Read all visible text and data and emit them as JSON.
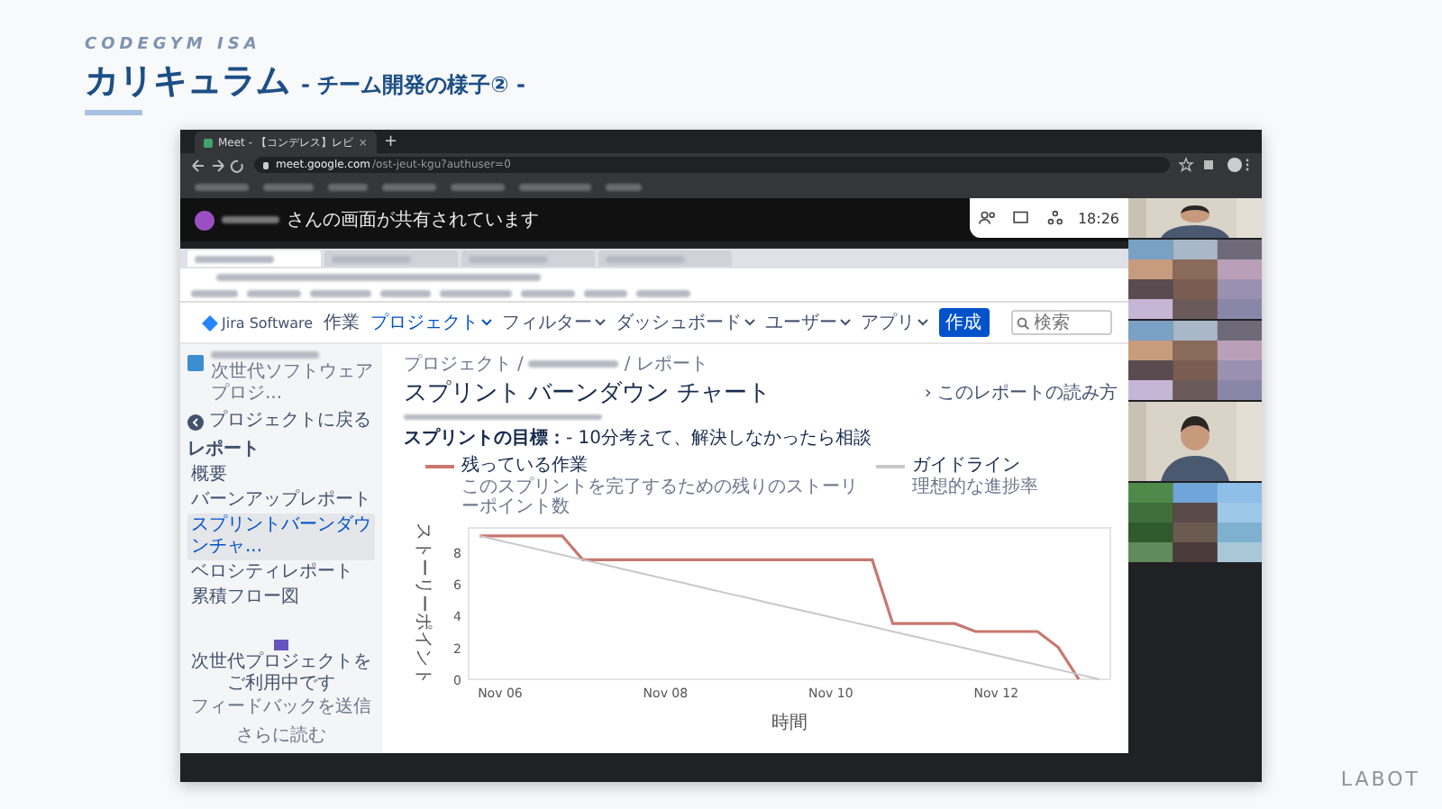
{
  "slide": {
    "brand": "CODEGYM ISA",
    "title": "カリキュラム",
    "subtitle": "- チーム開発の様子② -",
    "logo": "LABOT"
  },
  "browser": {
    "tabs": [
      {
        "label": "Meet - 【コンデレス】レビ",
        "selected": true,
        "close": "×"
      }
    ],
    "new_tab": "+",
    "url_host": "meet.google.com",
    "url_path": "/ost-jeut-kgu?authuser=0"
  },
  "meet": {
    "presenting_text": "さんの画面が共有されています",
    "time": "18:26",
    "tiles": [
      {
        "kind": "person"
      },
      {
        "kind": "mosaic"
      },
      {
        "kind": "mosaic"
      },
      {
        "kind": "person"
      },
      {
        "kind": "mosaic"
      }
    ]
  },
  "inner_browser": {
    "tabs": [
      {
        "selected": true
      },
      {
        "selected": false
      },
      {
        "selected": false
      },
      {
        "selected": false
      }
    ]
  },
  "jira": {
    "product": "Jira Software",
    "nav": [
      {
        "label": "作業",
        "dropdown": false,
        "selected": false
      },
      {
        "label": "プロジェクト",
        "dropdown": true,
        "selected": true
      },
      {
        "label": "フィルター",
        "dropdown": true,
        "selected": false
      },
      {
        "label": "ダッシュボード",
        "dropdown": true,
        "selected": false
      },
      {
        "label": "ユーザー",
        "dropdown": true,
        "selected": false
      },
      {
        "label": "アプリ",
        "dropdown": true,
        "selected": false
      }
    ],
    "create_button": "作成",
    "search": {
      "placeholder": "検索"
    },
    "sidebar": {
      "project_type": "次世代ソフトウェアプロジ...",
      "back": "プロジェクトに戻る",
      "heading": "レポート",
      "items": [
        {
          "label": "概要",
          "selected": false
        },
        {
          "label": "バーンアップレポート",
          "selected": false
        },
        {
          "label": "スプリントバーンダウンチャ...",
          "selected": true
        },
        {
          "label": "ベロシティレポート",
          "selected": false
        },
        {
          "label": "累積フロー図",
          "selected": false
        }
      ],
      "footer_text": "次世代プロジェクトをご利用中です",
      "feedback_link": "フィードバックを送信",
      "more_link": "さらに読む"
    },
    "breadcrumb": [
      "プロジェクト",
      "レポート"
    ],
    "breadcrumb_separator": "/",
    "title": "スプリント バーンダウン チャート",
    "help_link": "› このレポートの読み方",
    "sprint_goal_label": "スプリントの目標：",
    "sprint_goal": "- 10分考えて、解決しなかったら相談",
    "legend_descriptions": [
      "このスプリントを完了するための残りのストーリーポイント数",
      "理想的な進捗率"
    ],
    "chart_data": {
      "type": "line",
      "xlabel": "時間",
      "ylabel": "ストーリーポイント",
      "categories": [
        null,
        "Nov 06",
        null,
        null,
        null,
        null,
        null,
        null,
        null,
        "Nov 08",
        null,
        null,
        null,
        null,
        null,
        null,
        null,
        "Nov 10",
        null,
        null,
        null,
        null,
        null,
        null,
        null,
        "Nov 12",
        null,
        null,
        null,
        null,
        null
      ],
      "series": [
        {
          "name": "残っている作業",
          "color": "#c9776f",
          "values": [
            9,
            9,
            9,
            9,
            9,
            7.5,
            7.5,
            7.5,
            7.5,
            7.5,
            7.5,
            7.5,
            7.5,
            7.5,
            7.5,
            7.5,
            7.5,
            7.5,
            7.5,
            7.5,
            3.5,
            3.5,
            3.5,
            3.5,
            3,
            3,
            3,
            3,
            2,
            0,
            null
          ]
        },
        {
          "name": "ガイドライン",
          "color": "#c8c8c8",
          "values": [
            9,
            8.7,
            8.4,
            8.1,
            7.8,
            7.5,
            7.2,
            6.9,
            6.6,
            6.3,
            6,
            5.7,
            5.4,
            5.1,
            4.8,
            4.5,
            4.2,
            3.9,
            3.6,
            3.3,
            3,
            2.7,
            2.4,
            2.1,
            1.8,
            1.5,
            1.2,
            0.9,
            0.6,
            0.3,
            0
          ]
        }
      ],
      "ylim": [
        0,
        9.5
      ],
      "yticks": [
        0,
        2,
        4,
        6,
        8
      ]
    }
  }
}
